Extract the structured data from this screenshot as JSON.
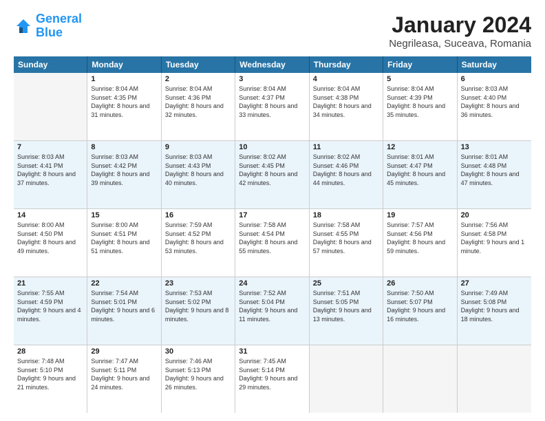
{
  "header": {
    "logo_line1": "General",
    "logo_line2": "Blue",
    "title": "January 2024",
    "subtitle": "Negrileasa, Suceava, Romania"
  },
  "calendar": {
    "days_of_week": [
      "Sunday",
      "Monday",
      "Tuesday",
      "Wednesday",
      "Thursday",
      "Friday",
      "Saturday"
    ],
    "weeks": [
      [
        {
          "day": "",
          "empty": true
        },
        {
          "day": "1",
          "sunrise": "Sunrise: 8:04 AM",
          "sunset": "Sunset: 4:35 PM",
          "daylight": "Daylight: 8 hours and 31 minutes."
        },
        {
          "day": "2",
          "sunrise": "Sunrise: 8:04 AM",
          "sunset": "Sunset: 4:36 PM",
          "daylight": "Daylight: 8 hours and 32 minutes."
        },
        {
          "day": "3",
          "sunrise": "Sunrise: 8:04 AM",
          "sunset": "Sunset: 4:37 PM",
          "daylight": "Daylight: 8 hours and 33 minutes."
        },
        {
          "day": "4",
          "sunrise": "Sunrise: 8:04 AM",
          "sunset": "Sunset: 4:38 PM",
          "daylight": "Daylight: 8 hours and 34 minutes."
        },
        {
          "day": "5",
          "sunrise": "Sunrise: 8:04 AM",
          "sunset": "Sunset: 4:39 PM",
          "daylight": "Daylight: 8 hours and 35 minutes."
        },
        {
          "day": "6",
          "sunrise": "Sunrise: 8:03 AM",
          "sunset": "Sunset: 4:40 PM",
          "daylight": "Daylight: 8 hours and 36 minutes."
        }
      ],
      [
        {
          "day": "7",
          "sunrise": "Sunrise: 8:03 AM",
          "sunset": "Sunset: 4:41 PM",
          "daylight": "Daylight: 8 hours and 37 minutes."
        },
        {
          "day": "8",
          "sunrise": "Sunrise: 8:03 AM",
          "sunset": "Sunset: 4:42 PM",
          "daylight": "Daylight: 8 hours and 39 minutes."
        },
        {
          "day": "9",
          "sunrise": "Sunrise: 8:03 AM",
          "sunset": "Sunset: 4:43 PM",
          "daylight": "Daylight: 8 hours and 40 minutes."
        },
        {
          "day": "10",
          "sunrise": "Sunrise: 8:02 AM",
          "sunset": "Sunset: 4:45 PM",
          "daylight": "Daylight: 8 hours and 42 minutes."
        },
        {
          "day": "11",
          "sunrise": "Sunrise: 8:02 AM",
          "sunset": "Sunset: 4:46 PM",
          "daylight": "Daylight: 8 hours and 44 minutes."
        },
        {
          "day": "12",
          "sunrise": "Sunrise: 8:01 AM",
          "sunset": "Sunset: 4:47 PM",
          "daylight": "Daylight: 8 hours and 45 minutes."
        },
        {
          "day": "13",
          "sunrise": "Sunrise: 8:01 AM",
          "sunset": "Sunset: 4:48 PM",
          "daylight": "Daylight: 8 hours and 47 minutes."
        }
      ],
      [
        {
          "day": "14",
          "sunrise": "Sunrise: 8:00 AM",
          "sunset": "Sunset: 4:50 PM",
          "daylight": "Daylight: 8 hours and 49 minutes."
        },
        {
          "day": "15",
          "sunrise": "Sunrise: 8:00 AM",
          "sunset": "Sunset: 4:51 PM",
          "daylight": "Daylight: 8 hours and 51 minutes."
        },
        {
          "day": "16",
          "sunrise": "Sunrise: 7:59 AM",
          "sunset": "Sunset: 4:52 PM",
          "daylight": "Daylight: 8 hours and 53 minutes."
        },
        {
          "day": "17",
          "sunrise": "Sunrise: 7:58 AM",
          "sunset": "Sunset: 4:54 PM",
          "daylight": "Daylight: 8 hours and 55 minutes."
        },
        {
          "day": "18",
          "sunrise": "Sunrise: 7:58 AM",
          "sunset": "Sunset: 4:55 PM",
          "daylight": "Daylight: 8 hours and 57 minutes."
        },
        {
          "day": "19",
          "sunrise": "Sunrise: 7:57 AM",
          "sunset": "Sunset: 4:56 PM",
          "daylight": "Daylight: 8 hours and 59 minutes."
        },
        {
          "day": "20",
          "sunrise": "Sunrise: 7:56 AM",
          "sunset": "Sunset: 4:58 PM",
          "daylight": "Daylight: 9 hours and 1 minute."
        }
      ],
      [
        {
          "day": "21",
          "sunrise": "Sunrise: 7:55 AM",
          "sunset": "Sunset: 4:59 PM",
          "daylight": "Daylight: 9 hours and 4 minutes."
        },
        {
          "day": "22",
          "sunrise": "Sunrise: 7:54 AM",
          "sunset": "Sunset: 5:01 PM",
          "daylight": "Daylight: 9 hours and 6 minutes."
        },
        {
          "day": "23",
          "sunrise": "Sunrise: 7:53 AM",
          "sunset": "Sunset: 5:02 PM",
          "daylight": "Daylight: 9 hours and 8 minutes."
        },
        {
          "day": "24",
          "sunrise": "Sunrise: 7:52 AM",
          "sunset": "Sunset: 5:04 PM",
          "daylight": "Daylight: 9 hours and 11 minutes."
        },
        {
          "day": "25",
          "sunrise": "Sunrise: 7:51 AM",
          "sunset": "Sunset: 5:05 PM",
          "daylight": "Daylight: 9 hours and 13 minutes."
        },
        {
          "day": "26",
          "sunrise": "Sunrise: 7:50 AM",
          "sunset": "Sunset: 5:07 PM",
          "daylight": "Daylight: 9 hours and 16 minutes."
        },
        {
          "day": "27",
          "sunrise": "Sunrise: 7:49 AM",
          "sunset": "Sunset: 5:08 PM",
          "daylight": "Daylight: 9 hours and 18 minutes."
        }
      ],
      [
        {
          "day": "28",
          "sunrise": "Sunrise: 7:48 AM",
          "sunset": "Sunset: 5:10 PM",
          "daylight": "Daylight: 9 hours and 21 minutes."
        },
        {
          "day": "29",
          "sunrise": "Sunrise: 7:47 AM",
          "sunset": "Sunset: 5:11 PM",
          "daylight": "Daylight: 9 hours and 24 minutes."
        },
        {
          "day": "30",
          "sunrise": "Sunrise: 7:46 AM",
          "sunset": "Sunset: 5:13 PM",
          "daylight": "Daylight: 9 hours and 26 minutes."
        },
        {
          "day": "31",
          "sunrise": "Sunrise: 7:45 AM",
          "sunset": "Sunset: 5:14 PM",
          "daylight": "Daylight: 9 hours and 29 minutes."
        },
        {
          "day": "",
          "empty": true
        },
        {
          "day": "",
          "empty": true
        },
        {
          "day": "",
          "empty": true
        }
      ]
    ]
  }
}
